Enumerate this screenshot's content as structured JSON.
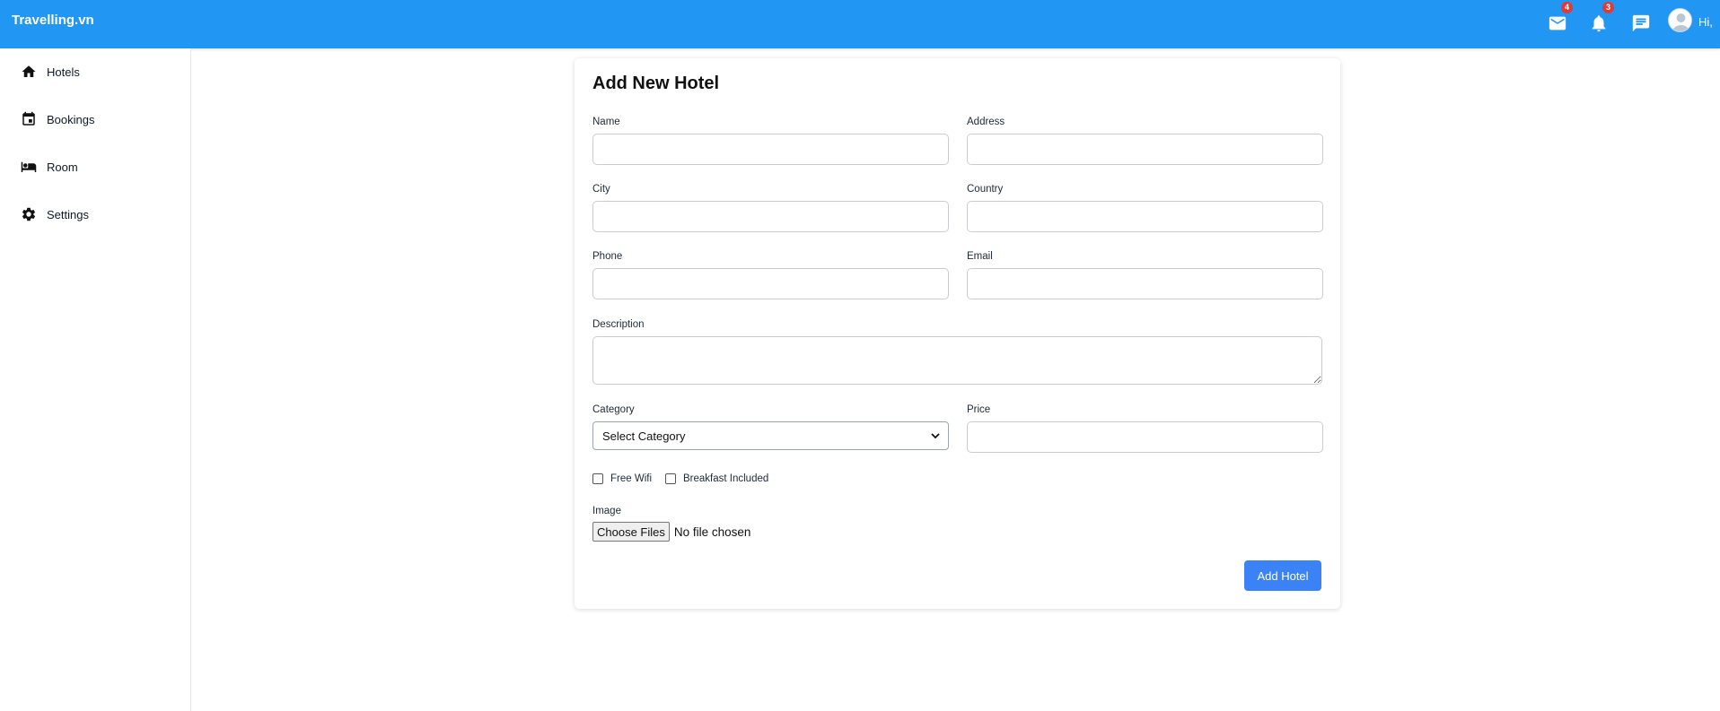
{
  "header": {
    "brand": "Travelling.vn",
    "mail_count": "4",
    "notification_count": "3",
    "greeting": "Hi,"
  },
  "sidebar": {
    "items": [
      {
        "label": "Hotels",
        "icon": "home-icon"
      },
      {
        "label": "Bookings",
        "icon": "calendar-icon"
      },
      {
        "label": "Room",
        "icon": "bed-icon"
      },
      {
        "label": "Settings",
        "icon": "gear-icon"
      }
    ]
  },
  "form": {
    "title": "Add New Hotel",
    "labels": {
      "name": "Name",
      "address": "Address",
      "city": "City",
      "country": "Country",
      "phone": "Phone",
      "email": "Email",
      "description": "Description",
      "category": "Category",
      "price": "Price",
      "image": "Image"
    },
    "category_selected": "Select Category",
    "checkboxes": {
      "free_wifi": "Free Wifi",
      "breakfast": "Breakfast Included"
    },
    "file_button": "Choose Files",
    "file_status": "No file chosen",
    "submit": "Add Hotel"
  },
  "colors": {
    "topbar": "#2196f3",
    "primary_button": "#3b82f6",
    "badge": "#e53935"
  }
}
